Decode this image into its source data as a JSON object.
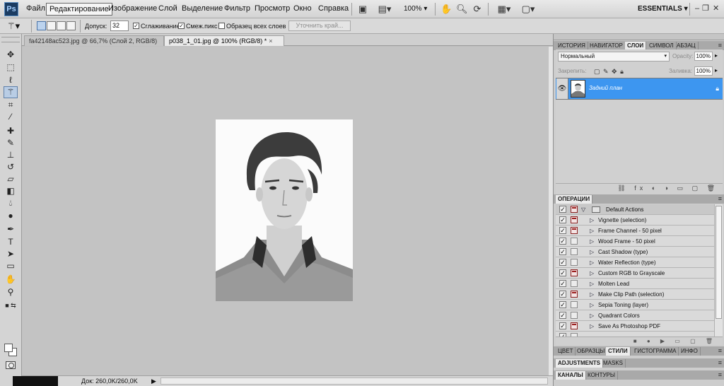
{
  "app": {
    "logo_text": "Ps"
  },
  "menu": {
    "items": [
      "Файл",
      "Редактирование",
      "Изображение",
      "Слой",
      "Выделение",
      "Фильтр",
      "Просмотр",
      "Окно",
      "Справка"
    ],
    "zoom": "100%",
    "workspace": "ESSENTIALS"
  },
  "options": {
    "tolerance_label": "Допуск:",
    "tolerance_value": "32",
    "antialias_label": "Сглаживание",
    "antialias_checked": "✓",
    "contiguous_label": "Смеж.пикс",
    "contiguous_checked": "✓",
    "sample_all_label": "Образец всех слоев",
    "refine_edge_label": "Уточнить край..."
  },
  "documents": {
    "tabs": [
      {
        "label": "fa42148ac523.jpg @ 66,7% (Слой 2, RGB/8) *",
        "close": "×"
      },
      {
        "label": "p038_1_01.jpg @ 100% (RGB/8) *",
        "close": "×"
      }
    ],
    "status_zoom": "",
    "status_text": "Док: 260,0K/260,0K"
  },
  "panels": {
    "top_tabs": [
      "ИСТОРИЯ",
      "НАВИГАТОР",
      "СЛОИ",
      "СИМВОЛ",
      "АБЗАЦ"
    ],
    "blend_mode": "Нормальный",
    "opacity_label": "Opacity:",
    "opacity_value": "100%",
    "lock_label": "Закрепить:",
    "fill_label": "Заливка:",
    "fill_value": "100%",
    "layer_name": "Задний план",
    "actions_tab": "ОПЕРАЦИИ",
    "actions": [
      {
        "label": "Default Actions",
        "folder": true,
        "dialog": false
      },
      {
        "label": "Vignette (selection)",
        "dialog": true
      },
      {
        "label": "Frame Channel - 50 pixel",
        "dialog": true
      },
      {
        "label": "Wood Frame - 50 pixel",
        "dialog": false
      },
      {
        "label": "Cast Shadow (type)",
        "dialog": false
      },
      {
        "label": "Water Reflection (type)",
        "dialog": false
      },
      {
        "label": "Custom RGB to Grayscale",
        "dialog": true
      },
      {
        "label": "Molten Lead",
        "dialog": false
      },
      {
        "label": "Make Clip Path (selection)",
        "dialog": true
      },
      {
        "label": "Sepia Toning (layer)",
        "dialog": false
      },
      {
        "label": "Quadrant Colors",
        "dialog": false
      },
      {
        "label": "Save As Photoshop PDF",
        "dialog": true
      }
    ],
    "bottom_tabs_1": [
      "ЦВЕТ",
      "ОБРАЗЦЫ",
      "СТИЛИ",
      "ГИСТОГРАММА",
      "ИНФО"
    ],
    "bottom_tabs_2": [
      "ADJUSTMENTS",
      "MASKS"
    ],
    "bottom_tabs_3": [
      "КАНАЛЫ",
      "КОНТУРЫ"
    ]
  },
  "colors": {
    "accent_selection": "#3d96f0",
    "foreground": "#ffffff",
    "background": "#ffffff",
    "action_dialog": "#9c1f1f"
  }
}
